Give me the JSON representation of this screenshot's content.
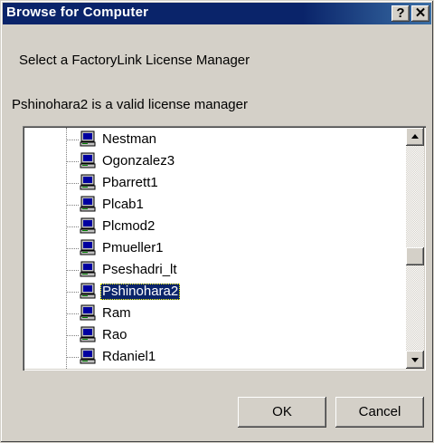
{
  "window": {
    "title": "Browse for Computer",
    "help_label": "?",
    "close_label": "✕"
  },
  "dialog": {
    "prompt": "Select a FactoryLink License Manager",
    "status": "Pshinohara2 is a valid license manager"
  },
  "tree": {
    "items": [
      {
        "label": "Nestman",
        "icon": "computer-icon"
      },
      {
        "label": "Ogonzalez3",
        "icon": "computer-icon"
      },
      {
        "label": "Pbarrett1",
        "icon": "computer-icon"
      },
      {
        "label": "Plcab1",
        "icon": "computer-icon"
      },
      {
        "label": "Plcmod2",
        "icon": "computer-icon"
      },
      {
        "label": "Pmueller1",
        "icon": "computer-icon"
      },
      {
        "label": "Pseshadri_lt",
        "icon": "computer-icon"
      },
      {
        "label": "Pshinohara2",
        "icon": "computer-icon",
        "selected": true
      },
      {
        "label": "Ram",
        "icon": "computer-icon"
      },
      {
        "label": "Rao",
        "icon": "computer-icon"
      },
      {
        "label": "Rdaniel1",
        "icon": "computer-icon"
      }
    ],
    "selected_index": 7
  },
  "buttons": {
    "ok_label": "OK",
    "cancel_label": "Cancel"
  },
  "colors": {
    "titlebar": "#0a246a",
    "face": "#d4d0c8",
    "selection": "#0a246a"
  }
}
